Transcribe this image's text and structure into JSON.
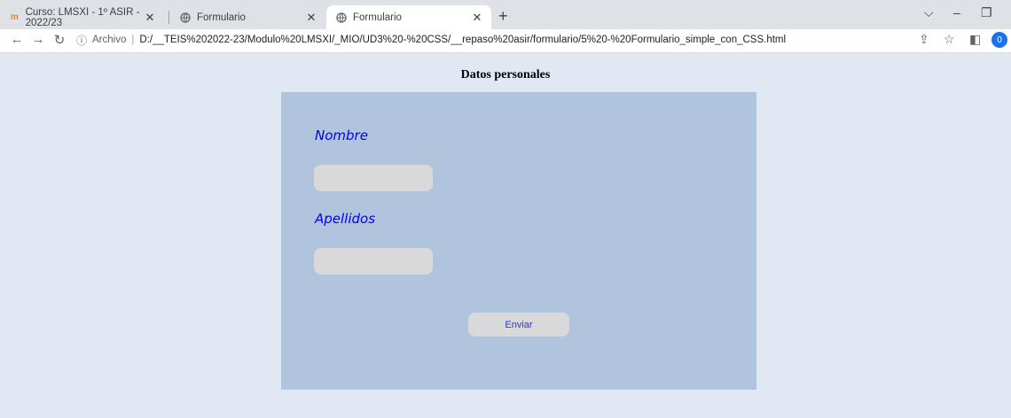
{
  "browser": {
    "tabs": [
      {
        "title": "Curso: LMSXI - 1º ASIR - 2022/23",
        "icon": "moodle-icon"
      },
      {
        "title": "Formulario",
        "icon": "globe-icon"
      },
      {
        "title": "Formulario",
        "icon": "globe-icon"
      }
    ],
    "address": {
      "scheme_label": "Archivo",
      "url": "D:/__TEIS%202022-23/Modulo%20LMSXI/_MIO/UD3%20-%20CSS/__repaso%20asir/formulario/5%20-%20Formulario_simple_con_CSS.html"
    },
    "profile_initial": "0"
  },
  "page": {
    "title": "Datos personales",
    "form": {
      "nombre_label": "Nombre",
      "nombre_value": "",
      "apellidos_label": "Apellidos",
      "apellidos_value": "",
      "submit_label": "Enviar"
    }
  },
  "colors": {
    "page_bg": "#e0e8f4",
    "form_bg": "#b0c4de",
    "label_color": "#0000ff",
    "field_bg": "#d9d9d9"
  }
}
